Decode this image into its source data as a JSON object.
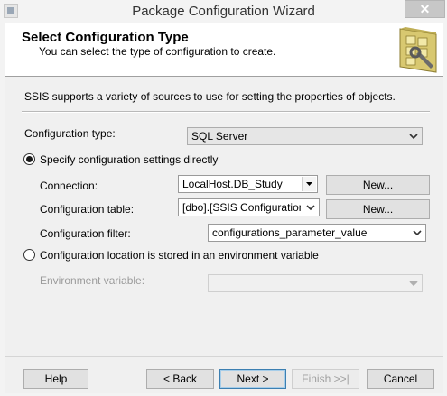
{
  "window": {
    "title": "Package Configuration Wizard",
    "close_label": "✕"
  },
  "header": {
    "title": "Select Configuration Type",
    "subtitle": "You can select the type of configuration to create."
  },
  "intro": "SSIS supports a variety of sources to use for setting the properties of objects.",
  "config_type": {
    "label": "Configuration type:",
    "value": "SQL Server"
  },
  "option_direct": {
    "label": "Specify configuration settings directly",
    "selected": true,
    "connection": {
      "label": "Connection:",
      "value": "LocalHost.DB_Study",
      "button": "New..."
    },
    "table": {
      "label": "Configuration table:",
      "value": "[dbo].[SSIS Configurations]",
      "button": "New..."
    },
    "filter": {
      "label": "Configuration filter:",
      "value": "configurations_parameter_value"
    }
  },
  "option_env": {
    "label": "Configuration location is stored in an environment variable",
    "selected": false,
    "variable": {
      "label": "Environment variable:",
      "value": ""
    }
  },
  "footer": {
    "help": "Help",
    "back": "< Back",
    "next": "Next >",
    "finish": "Finish >>|",
    "cancel": "Cancel"
  }
}
